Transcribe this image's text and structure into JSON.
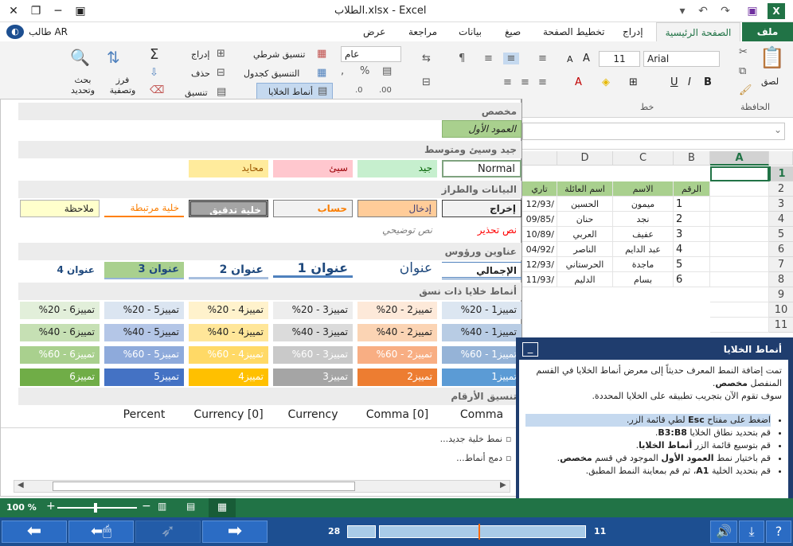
{
  "title": "الطلاب.xlsx - Excel",
  "user": "طالب AR",
  "tabs": [
    "ملف",
    "الصفحة الرئيسية",
    "إدراج",
    "تخطيط الصفحة",
    "صيغ",
    "بيانات",
    "مراجعة",
    "عرض"
  ],
  "ribbon": {
    "clipboard_label": "الحافظة",
    "paste": "لصق",
    "font_label": "خط",
    "font_name": "Arial",
    "font_size": "11",
    "number_format": "عام",
    "conditional": "تنسيق شرطي",
    "as_table": "التنسيق كجدول",
    "cell_styles": "أنماط الخلايا",
    "insert": "إدراج",
    "delete": "حذف",
    "format": "تنسيق",
    "sort": "فرز وتصفية",
    "find": "بحث وتحديد"
  },
  "gallery": {
    "custom": "مخصص",
    "custom_item": "العمود الأول",
    "good_bad": "جيد وسيئ ومتوسط",
    "gbn": [
      "Normal",
      "جيد",
      "سيئ",
      "محايد"
    ],
    "data_model": "البيانات والطراز",
    "dm1": [
      "إخراج",
      "إدخال",
      "حساب",
      "خلية تدقيق",
      "خلية مرتبطة",
      "ملاحظة"
    ],
    "dm2": [
      "نص تحذير",
      "نص توضيحي"
    ],
    "titles": "عناوين ورؤوس",
    "tt": [
      "الإجمالي",
      "عنوان",
      "عنوان 1",
      "عنوان 2",
      "عنوان 3",
      "عنوان 4"
    ],
    "themed": "أنماط خلايا ذات نسق",
    "r20": [
      "تمييز1 - 20%",
      "تمييز2 - 20%",
      "تمييز3 - 20%",
      "تمييز4 - 20%",
      "تمييز5 - 20%",
      "تمييز6 - 20%"
    ],
    "r40": [
      "تمييز1 - 40%",
      "تمييز2 - 40%",
      "تمييز3 - 40%",
      "تمييز4 - 40%",
      "تمييز5 - 40%",
      "تمييز6 - 40%"
    ],
    "r60": [
      "تمييز1 - 60%",
      "تمييز2 - 60%",
      "تمييز3 - 60%",
      "تمييز4 - 60%",
      "تمييز5 - 60%",
      "تمييز6 - 60%"
    ],
    "racc": [
      "تمييز1",
      "تمييز2",
      "تمييز3",
      "تمييز4",
      "تمييز5",
      "تمييز6"
    ],
    "number": "تنسيق الأرقام",
    "nf": [
      "Comma",
      "Comma [0]",
      "Currency",
      "Currency [0]",
      "Percent"
    ],
    "new_style": "نمط خلية جديد...",
    "merge_styles": "دمج أنماط..."
  },
  "sheet": {
    "cols": [
      "A",
      "B",
      "C",
      "D"
    ],
    "rows": [
      "1",
      "2",
      "3",
      "4",
      "5",
      "6",
      "7",
      "8",
      "9",
      "10",
      "11"
    ],
    "headers": [
      "الرقم",
      "الاسم",
      "اسم العائلة",
      "تاري"
    ],
    "data": [
      [
        "1",
        "ميمون",
        "الحسين",
        "12/93/"
      ],
      [
        "2",
        "نجد",
        "حنان",
        "09/85/"
      ],
      [
        "3",
        "عفيف",
        "العربي",
        "10/89/"
      ],
      [
        "4",
        "عبد الدايم",
        "الناصر",
        "04/92/"
      ],
      [
        "5",
        "ماجدة",
        "الحرستاني",
        "12/93/"
      ],
      [
        "6",
        "بسام",
        "الدليم",
        "11/93/"
      ]
    ]
  },
  "tutorial": {
    "title": "أنماط الخلايا",
    "p1a": "تمت إضافة النمط المعرف حديثاً إلى معرض أنماط الخلايا في القسم المنفصل",
    "p1b": "مخصص",
    "p2": "سوف تقوم الآن بتجريب تطبيقه على الخلايا المحددة.",
    "s1a": "اضغط على مفتاح ",
    "s1b": "Esc",
    "s1c": " لطي قائمة الزر.",
    "s2a": "قم بتحديد نطاق الخلايا ",
    "s2b": "B3:B8",
    "s3a": "قم بتوسيع قائمة الزر ",
    "s3b": "أنماط الخلايا",
    "s4a": "قم باختيار نمط ",
    "s4b": "العمود الأول",
    "s4c": " الموجود في قسم ",
    "s4d": "مخصص",
    "s5a": "قم بتحديد الخلية ",
    "s5b": "A1",
    "s5c": "، ثم قم بمعاينة النمط المطبق."
  },
  "zoom": "100 %",
  "progress": {
    "left": "28",
    "right": "11",
    "fraction": 0.55
  }
}
